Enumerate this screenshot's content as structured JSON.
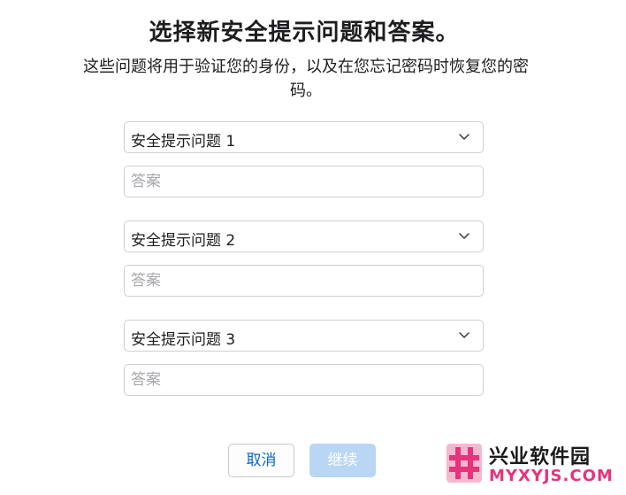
{
  "header": {
    "title": "选择新安全提示问题和答案。",
    "subtitle": "这些问题将用于验证您的身份，以及在您忘记密码时恢复您的密码。"
  },
  "questions": [
    {
      "select_value": "安全提示问题 1",
      "answer_placeholder": "答案",
      "answer_value": ""
    },
    {
      "select_value": "安全提示问题 2",
      "answer_placeholder": "答案",
      "answer_value": ""
    },
    {
      "select_value": "安全提示问题 3",
      "answer_placeholder": "答案",
      "answer_value": ""
    }
  ],
  "footer": {
    "cancel_label": "取消",
    "continue_label": "继续"
  },
  "watermark": {
    "brand_cn": "兴业软件园",
    "brand_domain": "MYXYJS.COM"
  },
  "colors": {
    "link_blue": "#0a66cf",
    "disabled_blue": "#b9d6f4",
    "border": "#cfcfd4",
    "watermark_pink": "#e6337c"
  },
  "icons": {
    "select_indicator": "chevron-down-icon",
    "watermark_logo": "hash-logo"
  }
}
